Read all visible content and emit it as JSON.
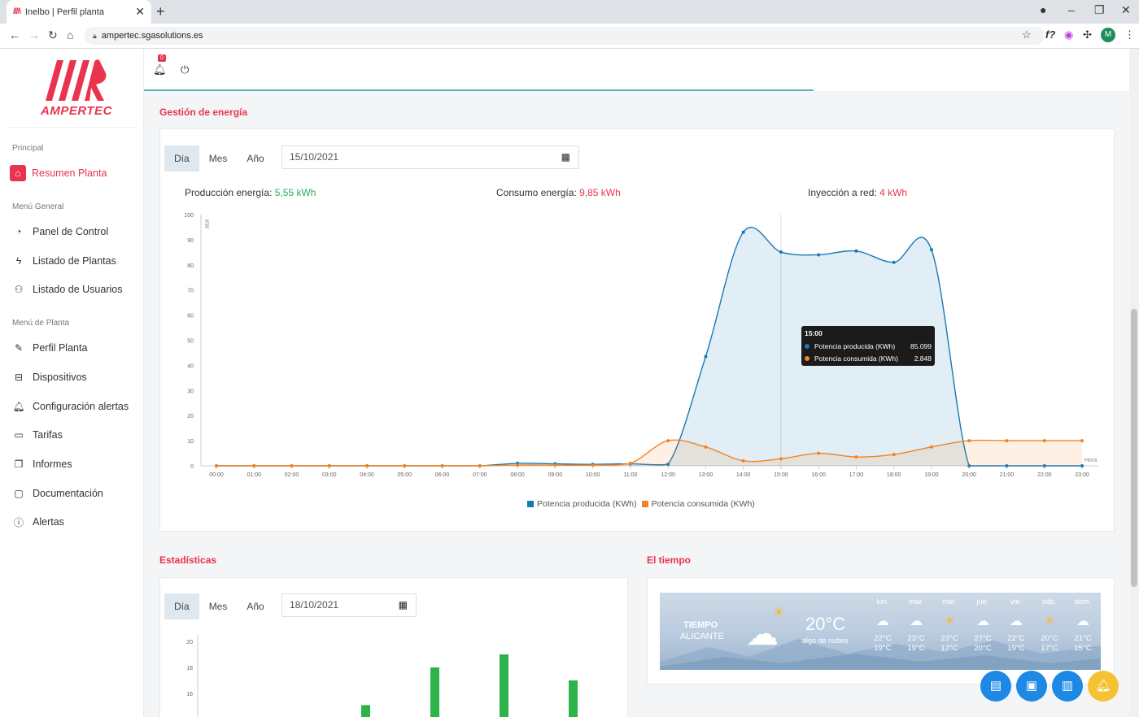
{
  "browser": {
    "tab_title": "Inelbo | Perfil planta",
    "tab_icon": "////\\",
    "url": "ampertec.sgasolutions.es",
    "profile_initial": "M"
  },
  "sidebar": {
    "logo_text": "AMPERTEC",
    "sections": [
      {
        "label": "Principal"
      },
      {
        "label": "Menú General"
      },
      {
        "label": "Menú de Planta"
      }
    ],
    "items": [
      {
        "label": "Resumen Planta",
        "icon": "home-icon"
      },
      {
        "label": "Panel de Control",
        "icon": "gauge-icon"
      },
      {
        "label": "Listado de Plantas",
        "icon": "lightning-icon"
      },
      {
        "label": "Listado de Usuarios",
        "icon": "users-icon"
      },
      {
        "label": "Perfil Planta",
        "icon": "edit-icon"
      },
      {
        "label": "Dispositivos",
        "icon": "inbox-icon"
      },
      {
        "label": "Configuración alertas",
        "icon": "bell-icon"
      },
      {
        "label": "Tarifas",
        "icon": "card-icon"
      },
      {
        "label": "Informes",
        "icon": "copy-icon"
      },
      {
        "label": "Documentación",
        "icon": "folder-icon"
      },
      {
        "label": "Alertas",
        "icon": "info-icon"
      }
    ]
  },
  "topbar": {
    "notification_count": "0"
  },
  "energy": {
    "title": "Gestión de energía",
    "tabs": [
      "Día",
      "Mes",
      "Año"
    ],
    "selected_tab": "Día",
    "date": "15/10/2021",
    "production_label": "Producción energía:",
    "production_value": "5,55 kWh",
    "consumption_label": "Consumo energía:",
    "consumption_value": "9,85 kWh",
    "injection_label": "Inyección a red:",
    "injection_value": "4 kWh",
    "tooltip": {
      "time": "15:00",
      "rows": [
        {
          "label": "Potencia producida (KWh)",
          "value": "85.099",
          "color": "#1a78b4"
        },
        {
          "label": "Potencia consumida (KWh)",
          "value": "2.848",
          "color": "#f58220"
        }
      ]
    }
  },
  "stats": {
    "title": "Estadísticas",
    "tabs": [
      "Día",
      "Mes",
      "Año"
    ],
    "selected_tab": "Día",
    "date": "18/10/2021"
  },
  "weather": {
    "title": "El tiempo",
    "heading": "TIEMPO",
    "city": "ALICANTE",
    "current_temp": "20°C",
    "condition": "algo de nubes",
    "days": [
      {
        "name": "lun.",
        "icon": "cloud-icon",
        "high": "22°C",
        "low": "19°C"
      },
      {
        "name": "mar.",
        "icon": "cloud-icon",
        "high": "23°C",
        "low": "19°C"
      },
      {
        "name": "mié.",
        "icon": "sun-icon",
        "high": "23°C",
        "low": "17°C"
      },
      {
        "name": "jue.",
        "icon": "cloud-icon",
        "high": "27°C",
        "low": "20°C"
      },
      {
        "name": "vie.",
        "icon": "cloud-icon",
        "high": "22°C",
        "low": "19°C"
      },
      {
        "name": "sáb.",
        "icon": "sun-icon",
        "high": "20°C",
        "low": "17°C"
      },
      {
        "name": "dom.",
        "icon": "cloud-icon",
        "high": "21°C",
        "low": "15°C"
      }
    ]
  },
  "colors": {
    "accent": "#e8344e",
    "produced": "#1a78b4",
    "consumed": "#f58220",
    "bars": "#2db34a"
  },
  "chart_data": [
    {
      "type": "area",
      "title": "",
      "xlabel": "Hora",
      "ylabel": "KW",
      "ylim": [
        0,
        100
      ],
      "yticks": [
        0,
        10,
        20,
        30,
        40,
        50,
        60,
        70,
        80,
        90,
        100
      ],
      "legend_placement": "bottom",
      "x": [
        "00:00",
        "01:00",
        "02:00",
        "03:00",
        "04:00",
        "05:00",
        "06:00",
        "07:00",
        "08:00",
        "09:00",
        "10:00",
        "11:00",
        "12:00",
        "13:00",
        "14:00",
        "15:00",
        "16:00",
        "17:00",
        "18:00",
        "19:00",
        "20:00",
        "21:00",
        "22:00",
        "23:00"
      ],
      "series": [
        {
          "name": "Potencia producida (KWh)",
          "color": "#1a78b4",
          "values": [
            0,
            0,
            0,
            0,
            0,
            0,
            0,
            0,
            1,
            0.8,
            0.6,
            0.8,
            0.6,
            43.5,
            93,
            85.1,
            84,
            85.5,
            81,
            86,
            0,
            0,
            0,
            0
          ]
        },
        {
          "name": "Potencia consumida (KWh)",
          "color": "#f58220",
          "values": [
            0,
            0,
            0,
            0,
            0,
            0,
            0,
            0,
            0.3,
            0.3,
            0.3,
            1,
            10,
            7.5,
            2,
            2.8,
            5,
            3.5,
            4.5,
            7.5,
            10,
            10,
            10,
            10
          ]
        }
      ]
    },
    {
      "type": "bar",
      "title": "",
      "ylim": [
        15,
        21
      ],
      "yticks": [
        16,
        18,
        20
      ],
      "series": [
        {
          "name": "",
          "color": "#2db34a",
          "values": [
            15.1,
            18,
            19,
            17
          ]
        }
      ]
    }
  ]
}
